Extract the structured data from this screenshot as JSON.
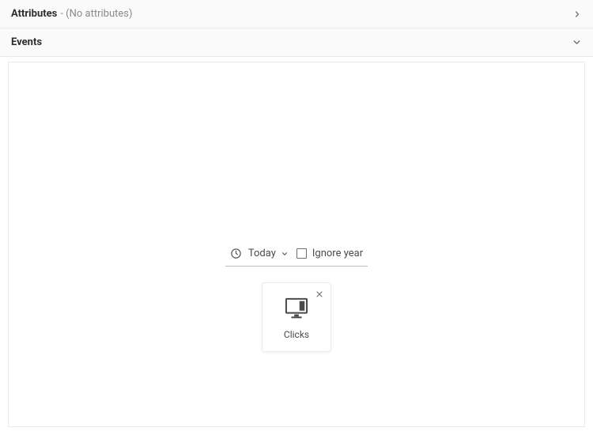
{
  "sections": {
    "attributes": {
      "title": "Attributes",
      "subtitle": "- (No attributes)"
    },
    "events": {
      "title": "Events"
    }
  },
  "dateFilter": {
    "selected": "Today",
    "ignoreYearLabel": "Ignore year"
  },
  "eventCard": {
    "label": "Clicks",
    "icon": "monitor-icon"
  }
}
